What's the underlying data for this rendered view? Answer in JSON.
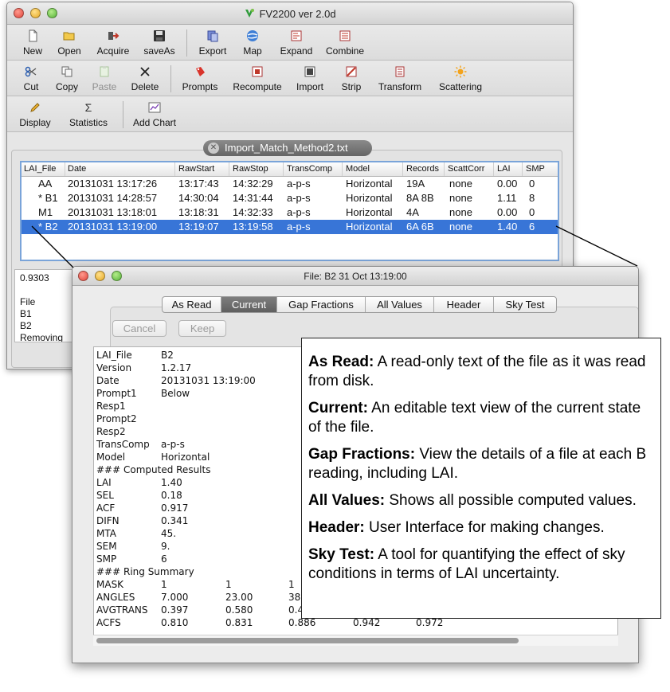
{
  "main_window": {
    "title": "FV2200 ver 2.0d",
    "toolbar_row1": [
      {
        "label": "New",
        "icon": "new-file-icon"
      },
      {
        "label": "Open",
        "icon": "folder-icon"
      },
      {
        "label": "Acquire",
        "icon": "acquire-arrow-icon"
      },
      {
        "label": "saveAs",
        "icon": "floppy-disk-icon"
      },
      {
        "label": "Export",
        "icon": "export-icon"
      },
      {
        "label": "Map",
        "icon": "globe-icon"
      },
      {
        "label": "Expand",
        "icon": "expand-icon"
      },
      {
        "label": "Combine",
        "icon": "combine-icon"
      }
    ],
    "toolbar_row2": [
      {
        "label": "Cut",
        "icon": "scissors-icon"
      },
      {
        "label": "Copy",
        "icon": "copy-icon"
      },
      {
        "label": "Paste",
        "icon": "paste-icon",
        "disabled": true
      },
      {
        "label": "Delete",
        "icon": "delete-icon"
      },
      {
        "label": "Prompts",
        "icon": "prompts-icon"
      },
      {
        "label": "Recompute",
        "icon": "recompute-icon"
      },
      {
        "label": "Import",
        "icon": "import-icon"
      },
      {
        "label": "Strip",
        "icon": "strip-icon"
      },
      {
        "label": "Transform",
        "icon": "transform-icon"
      },
      {
        "label": "Scattering",
        "icon": "sun-icon"
      }
    ],
    "toolbar_row3": [
      {
        "label": "Display",
        "icon": "pencil-icon"
      },
      {
        "label": "Statistics",
        "icon": "sigma-icon"
      },
      {
        "label": "Add Chart",
        "icon": "chart-icon"
      }
    ],
    "open_file_tab": "Import_Match_Method2.txt",
    "table": {
      "columns": [
        "LAI_File",
        "Date",
        "RawStart",
        "RawStop",
        "TransComp",
        "Model",
        "Records",
        "ScattCorr",
        "LAI",
        "SMP"
      ],
      "rows": [
        {
          "cells": [
            "AA",
            "20131031 13:17:26",
            "13:17:43",
            "14:32:29",
            "a-p-s",
            "Horizontal",
            "19A",
            "none",
            "0.00",
            "0"
          ],
          "selected": false
        },
        {
          "cells": [
            "* B1",
            "20131031 14:28:57",
            "14:30:04",
            "14:31:44",
            "a-p-s",
            "Horizontal",
            "8A 8B",
            "none",
            "1.11",
            "8"
          ],
          "selected": false
        },
        {
          "cells": [
            "M1",
            "20131031 13:18:01",
            "13:18:31",
            "14:32:33",
            "a-p-s",
            "Horizontal",
            "4A",
            "none",
            "0.00",
            "0"
          ],
          "selected": false
        },
        {
          "cells": [
            "* B2",
            "20131031 13:19:00",
            "13:19:07",
            "13:19:58",
            "a-p-s",
            "Horizontal",
            "6A 6B",
            "none",
            "1.40",
            "6"
          ],
          "selected": true
        }
      ]
    },
    "text_pane_lines": [
      "0.9303",
      "",
      "File",
      "B1",
      "B2",
      "Removing"
    ]
  },
  "dialog": {
    "title": "File: B2  31 Oct 13:19:00",
    "tabs": [
      {
        "label": "As Read",
        "active": false
      },
      {
        "label": "Current",
        "active": true
      },
      {
        "label": "Gap Fractions",
        "active": false
      },
      {
        "label": "All Values",
        "active": false
      },
      {
        "label": "Header",
        "active": false
      },
      {
        "label": "Sky Test",
        "active": false
      }
    ],
    "cancel_label": "Cancel",
    "keep_label": "Keep",
    "file_lines": [
      {
        "key": "LAI_File",
        "values": [
          "B2"
        ]
      },
      {
        "key": "Version",
        "values": [
          "1.2.17"
        ]
      },
      {
        "key": "Date",
        "values": [
          "20131031 13:19:00"
        ]
      },
      {
        "key": "Prompt1",
        "values": [
          "Below"
        ]
      },
      {
        "key": "Resp1",
        "values": []
      },
      {
        "key": "Prompt2",
        "values": []
      },
      {
        "key": "Resp2",
        "values": []
      },
      {
        "key": "TransComp",
        "values": [
          "a-p-s"
        ]
      },
      {
        "key": "Model",
        "values": [
          "Horizontal"
        ]
      },
      {
        "key": "### Computed Results",
        "values": []
      },
      {
        "key": "LAI",
        "values": [
          "1.40"
        ]
      },
      {
        "key": "SEL",
        "values": [
          "0.18"
        ]
      },
      {
        "key": "ACF",
        "values": [
          "0.917"
        ]
      },
      {
        "key": "DIFN",
        "values": [
          "0.341"
        ]
      },
      {
        "key": "MTA",
        "values": [
          "45."
        ]
      },
      {
        "key": "SEM",
        "values": [
          "9."
        ]
      },
      {
        "key": "SMP",
        "values": [
          "6"
        ]
      },
      {
        "key": "### Ring Summary",
        "values": []
      },
      {
        "key": "MASK",
        "values": [
          "1",
          "1",
          "1"
        ]
      },
      {
        "key": "ANGLES",
        "values": [
          "7.000",
          "23.00",
          "38"
        ]
      },
      {
        "key": "AVGTRANS",
        "values": [
          "0.397",
          "0.580",
          "0.4"
        ]
      },
      {
        "key": "ACFS",
        "values": [
          "0.810",
          "0.831",
          "0.886",
          "0.942",
          "0.972"
        ]
      }
    ]
  },
  "callout": {
    "items": [
      {
        "term": "As Read:",
        "text": " A read-only text of the file as it was read from disk."
      },
      {
        "term": "Current:",
        "text": " An editable text view of the current state of the file."
      },
      {
        "term": "Gap Fractions:",
        "text": " View the details of a file at each B reading, including LAI."
      },
      {
        "term": "All Values:",
        "text": " Shows all possible computed values."
      },
      {
        "term": "Header:",
        "text": " User Interface for making changes."
      },
      {
        "term": "Sky Test:",
        "text": " A tool for quantifying the effect of sky conditions in terms of LAI uncertainty."
      }
    ]
  },
  "colors": {
    "selection": "#3875d7",
    "table_border": "#7aa4d9",
    "active_tab": "#6e6e6e"
  }
}
